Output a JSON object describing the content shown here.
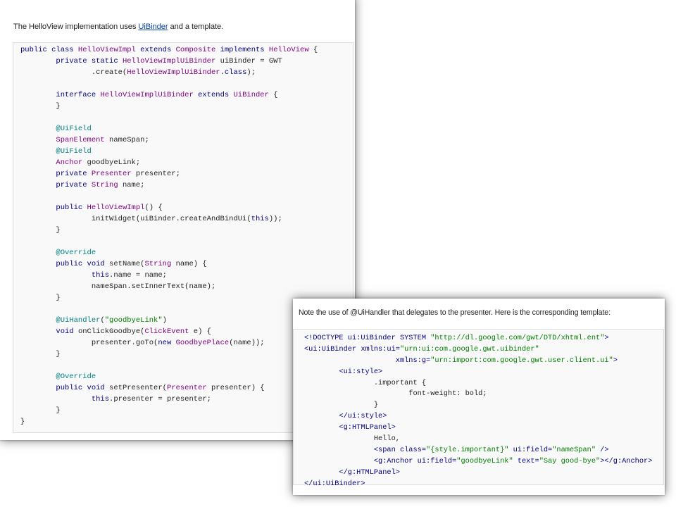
{
  "card1": {
    "intro": {
      "before": "The HelloView implementation uses ",
      "link": "UiBinder",
      "after": " and a template."
    },
    "code": [
      [
        [
          "kw",
          "public class "
        ],
        [
          "ty",
          "HelloViewImpl"
        ],
        [
          "kw",
          " extends "
        ],
        [
          "ty",
          "Composite"
        ],
        [
          "kw",
          " implements "
        ],
        [
          "ty",
          "HelloView"
        ],
        [
          "pl",
          " {"
        ]
      ],
      [
        [
          "pl",
          "        "
        ],
        [
          "kw",
          "private static "
        ],
        [
          "ty",
          "HelloViewImplUiBinder"
        ],
        [
          "pl",
          " uiBinder = GWT"
        ]
      ],
      [
        [
          "pl",
          "                .create("
        ],
        [
          "ty",
          "HelloViewImplUiBinder"
        ],
        [
          "pl",
          "."
        ],
        [
          "kw",
          "class"
        ],
        [
          "pl",
          ");"
        ]
      ],
      [],
      [
        [
          "pl",
          "        "
        ],
        [
          "kw",
          "interface "
        ],
        [
          "ty",
          "HelloViewImplUiBinder"
        ],
        [
          "kw",
          " extends "
        ],
        [
          "ty",
          "UiBinder"
        ],
        [
          "pl",
          " {"
        ]
      ],
      [
        [
          "pl",
          "        }"
        ]
      ],
      [],
      [
        [
          "pl",
          "        "
        ],
        [
          "an",
          "@UiField"
        ]
      ],
      [
        [
          "pl",
          "        "
        ],
        [
          "ty",
          "SpanElement"
        ],
        [
          "pl",
          " nameSpan;"
        ]
      ],
      [
        [
          "pl",
          "        "
        ],
        [
          "an",
          "@UiField"
        ]
      ],
      [
        [
          "pl",
          "        "
        ],
        [
          "ty",
          "Anchor"
        ],
        [
          "pl",
          " goodbyeLink;"
        ]
      ],
      [
        [
          "pl",
          "        "
        ],
        [
          "kw",
          "private "
        ],
        [
          "ty",
          "Presenter"
        ],
        [
          "pl",
          " presenter;"
        ]
      ],
      [
        [
          "pl",
          "        "
        ],
        [
          "kw",
          "private "
        ],
        [
          "ty",
          "String"
        ],
        [
          "pl",
          " name;"
        ]
      ],
      [],
      [
        [
          "pl",
          "        "
        ],
        [
          "kw",
          "public "
        ],
        [
          "ty",
          "HelloViewImpl"
        ],
        [
          "pl",
          "() {"
        ]
      ],
      [
        [
          "pl",
          "                initWidget(uiBinder.createAndBindUi("
        ],
        [
          "kw",
          "this"
        ],
        [
          "pl",
          "));"
        ]
      ],
      [
        [
          "pl",
          "        }"
        ]
      ],
      [],
      [
        [
          "pl",
          "        "
        ],
        [
          "an",
          "@Override"
        ]
      ],
      [
        [
          "pl",
          "        "
        ],
        [
          "kw",
          "public void "
        ],
        [
          "pl",
          "setName("
        ],
        [
          "ty",
          "String"
        ],
        [
          "pl",
          " name) {"
        ]
      ],
      [
        [
          "pl",
          "                "
        ],
        [
          "kw",
          "this"
        ],
        [
          "pl",
          ".name = name;"
        ]
      ],
      [
        [
          "pl",
          "                nameSpan.setInnerText(name);"
        ]
      ],
      [
        [
          "pl",
          "        }"
        ]
      ],
      [],
      [
        [
          "pl",
          "        "
        ],
        [
          "an",
          "@UiHandler"
        ],
        [
          "pl",
          "("
        ],
        [
          "st",
          "\"goodbyeLink\""
        ],
        [
          "pl",
          ")"
        ]
      ],
      [
        [
          "pl",
          "        "
        ],
        [
          "kw",
          "void "
        ],
        [
          "pl",
          "onClickGoodbye("
        ],
        [
          "ty",
          "ClickEvent"
        ],
        [
          "pl",
          " e) {"
        ]
      ],
      [
        [
          "pl",
          "                presenter.goTo("
        ],
        [
          "kw",
          "new "
        ],
        [
          "ty",
          "GoodbyePlace"
        ],
        [
          "pl",
          "(name));"
        ]
      ],
      [
        [
          "pl",
          "        }"
        ]
      ],
      [],
      [
        [
          "pl",
          "        "
        ],
        [
          "an",
          "@Override"
        ]
      ],
      [
        [
          "pl",
          "        "
        ],
        [
          "kw",
          "public void "
        ],
        [
          "pl",
          "setPresenter("
        ],
        [
          "ty",
          "Presenter"
        ],
        [
          "pl",
          " presenter) {"
        ]
      ],
      [
        [
          "pl",
          "                "
        ],
        [
          "kw",
          "this"
        ],
        [
          "pl",
          ".presenter = presenter;"
        ]
      ],
      [
        [
          "pl",
          "        }"
        ]
      ],
      [
        [
          "pl",
          "}"
        ]
      ]
    ]
  },
  "card2": {
    "intro": "Note the use of @UiHandler that delegates to the presenter. Here is the corresponding template:",
    "code": [
      [
        [
          "tg",
          "<!DOCTYPE ui:UiBinder SYSTEM "
        ],
        [
          "av",
          "\"http://dl.google.com/gwt/DTD/xhtml.ent\""
        ],
        [
          "tg",
          ">"
        ]
      ],
      [
        [
          "tg",
          "<ui:UiBinder "
        ],
        [
          "at",
          "xmlns:ui="
        ],
        [
          "av",
          "\"urn:ui:com.google.gwt.uibinder\""
        ]
      ],
      [
        [
          "pl",
          "                     "
        ],
        [
          "at",
          "xmlns:g="
        ],
        [
          "av",
          "\"urn:import:com.google.gwt.user.client.ui\""
        ],
        [
          "tg",
          ">"
        ]
      ],
      [
        [
          "pl",
          "        "
        ],
        [
          "tg",
          "<ui:style>"
        ]
      ],
      [
        [
          "pl",
          "                .important {"
        ]
      ],
      [
        [
          "pl",
          "                        font-weight: bold;"
        ]
      ],
      [
        [
          "pl",
          "                }"
        ]
      ],
      [
        [
          "pl",
          "        "
        ],
        [
          "tg",
          "</ui:style>"
        ]
      ],
      [
        [
          "pl",
          "        "
        ],
        [
          "tg",
          "<g:HTMLPanel>"
        ]
      ],
      [
        [
          "pl",
          "                Hello,"
        ]
      ],
      [
        [
          "pl",
          "                "
        ],
        [
          "tg",
          "<span "
        ],
        [
          "at",
          "class="
        ],
        [
          "av",
          "\"{style.important}\""
        ],
        [
          "at",
          " ui:field="
        ],
        [
          "av",
          "\"nameSpan\""
        ],
        [
          "tg",
          " />"
        ]
      ],
      [
        [
          "pl",
          "                "
        ],
        [
          "tg",
          "<g:Anchor "
        ],
        [
          "at",
          "ui:field="
        ],
        [
          "av",
          "\"goodbyeLink\""
        ],
        [
          "at",
          " text="
        ],
        [
          "av",
          "\"Say good-bye\""
        ],
        [
          "tg",
          "></g:Anchor>"
        ]
      ],
      [
        [
          "pl",
          "        "
        ],
        [
          "tg",
          "</g:HTMLPanel>"
        ]
      ],
      [
        [
          "tg",
          "</ui:UiBinder>"
        ]
      ]
    ]
  }
}
